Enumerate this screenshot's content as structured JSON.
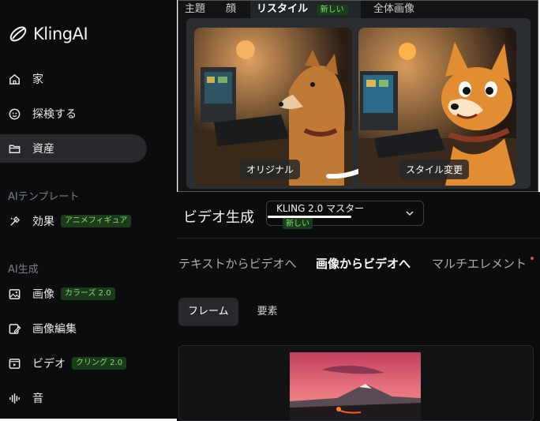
{
  "app": {
    "name": "KlingAI"
  },
  "sidebar": {
    "items": [
      {
        "label": "家",
        "icon": "home-icon"
      },
      {
        "label": "探検する",
        "icon": "explore-icon"
      },
      {
        "label": "資産",
        "icon": "folder-icon"
      }
    ],
    "sections": [
      {
        "title": "AIテンプレート",
        "items": [
          {
            "label": "効果",
            "badge": "アニメフィギュア",
            "icon": "effects-icon"
          }
        ]
      },
      {
        "title": "AI生成",
        "items": [
          {
            "label": "画像",
            "badge": "カラーズ 2.0",
            "icon": "image-icon"
          },
          {
            "label": "画像編集",
            "icon": "image-edit-icon"
          },
          {
            "label": "ビデオ",
            "badge": "クリング 2.0",
            "icon": "video-icon"
          },
          {
            "label": "音",
            "icon": "sound-icon"
          }
        ]
      }
    ]
  },
  "example_panel": {
    "tabs": [
      "主題",
      "顔",
      "リスタイル",
      "全体画像"
    ],
    "active_tab": "リスタイル",
    "active_badge": "新しい",
    "left_label": "オリジナル",
    "right_label": "スタイル変更"
  },
  "generation": {
    "title": "ビデオ生成",
    "model": {
      "name": "KLING 2.0 マスター",
      "badge": "新しい"
    },
    "tabs": [
      "テキストからビデオへ",
      "画像からビデオへ",
      "マルチエレメント"
    ],
    "active_tab": "画像からビデオへ",
    "sub_tabs": [
      "フレーム",
      "要素"
    ],
    "active_sub_tab": "フレーム"
  },
  "colors": {
    "accent_badge_text": "#7ee06a",
    "accent_badge_bg": "#1e3a1d",
    "sidebar_bg": "#0b0c0d"
  }
}
